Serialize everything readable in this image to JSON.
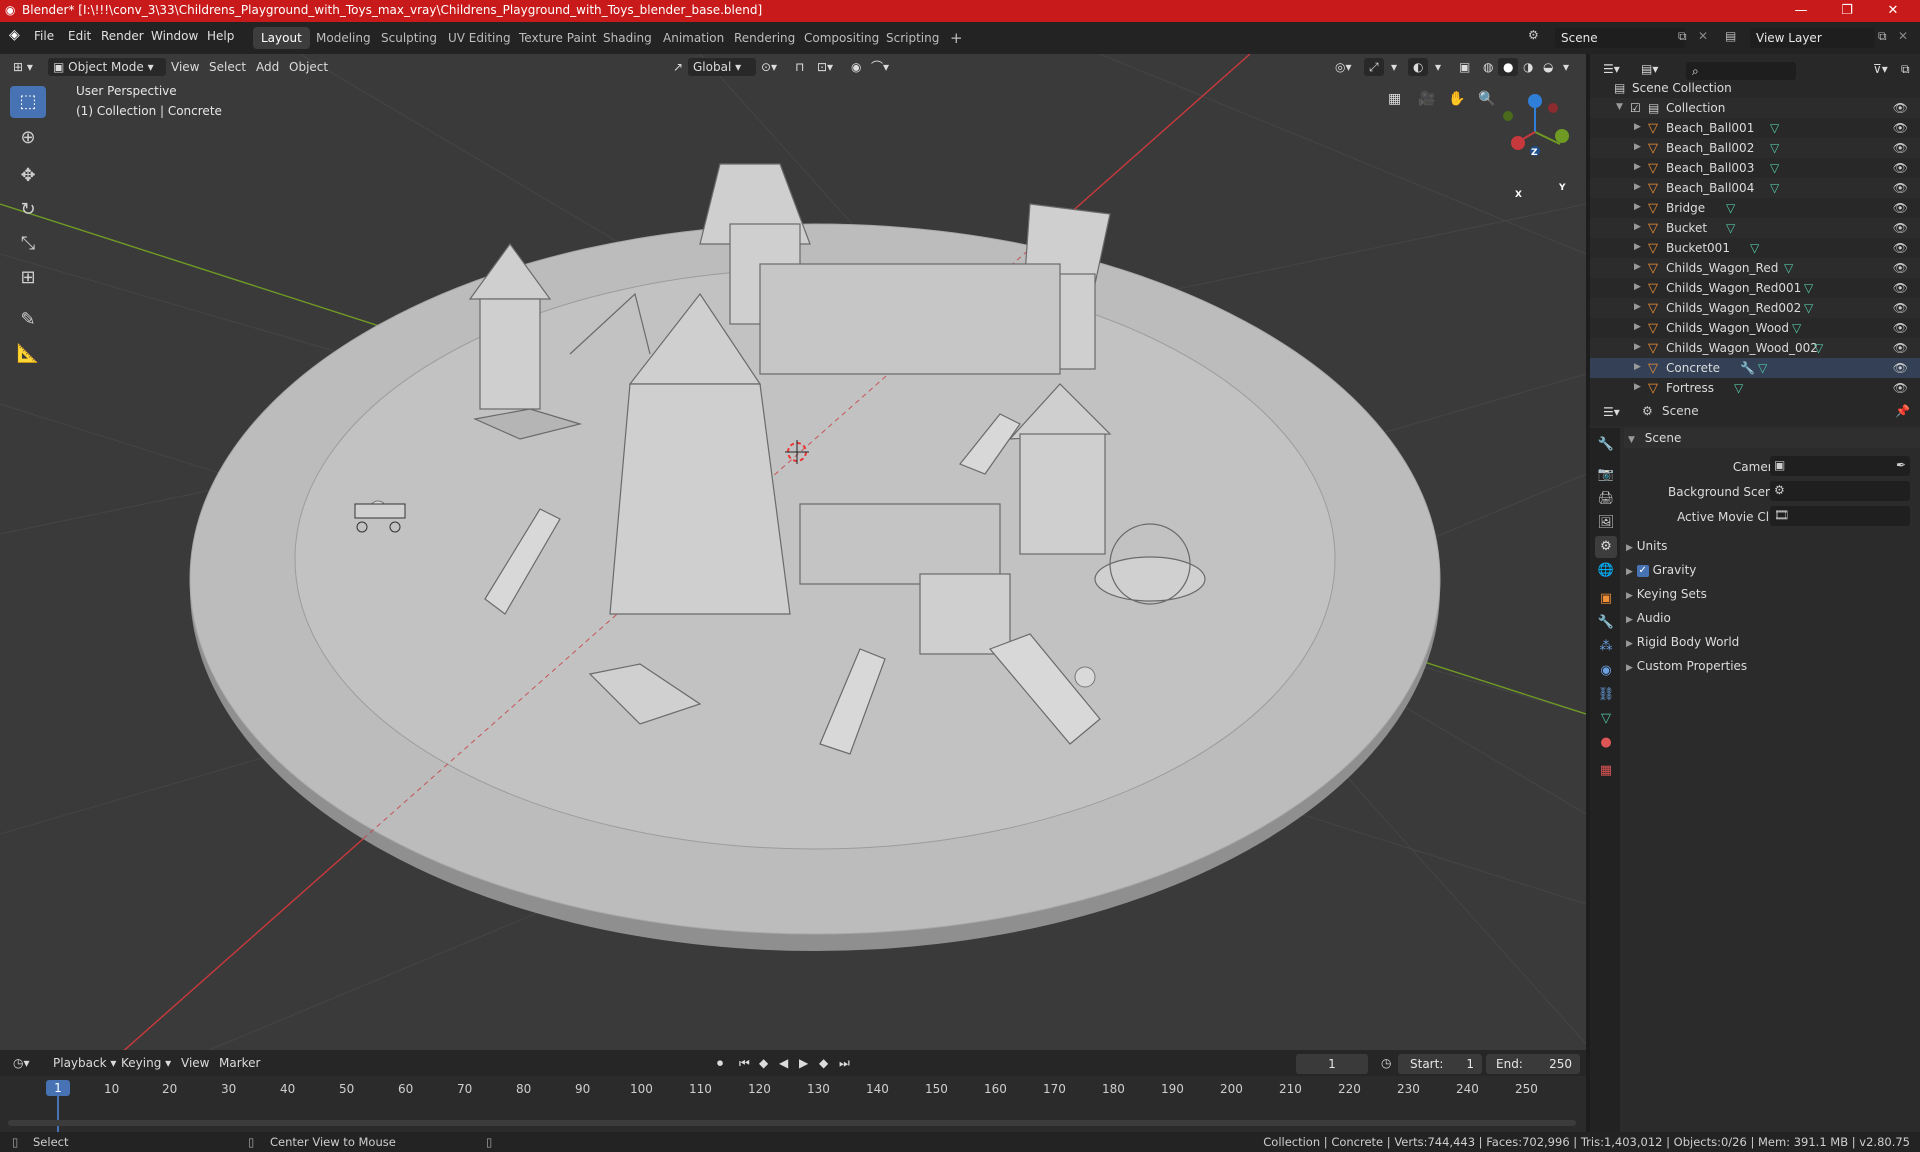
{
  "title_bar": {
    "title": "Blender* [I:\\!!!\\conv_3\\33\\Childrens_Playground_with_Toys_max_vray\\Childrens_Playground_with_Toys_blender_base.blend]",
    "minimize": "—",
    "maximize": "❐",
    "close": "✕"
  },
  "menu": {
    "logo": "◈",
    "items": [
      "File",
      "Edit",
      "Render",
      "Window",
      "Help"
    ],
    "workspaces": [
      "Layout",
      "Modeling",
      "Sculpting",
      "UV Editing",
      "Texture Paint",
      "Shading",
      "Animation",
      "Rendering",
      "Compositing",
      "Scripting"
    ],
    "active_workspace": "Layout",
    "add_tab": "+",
    "scene_label": "Scene",
    "view_layer_label": "View Layer"
  },
  "viewport": {
    "mode": "Object Mode",
    "menu": [
      "View",
      "Select",
      "Add",
      "Object"
    ],
    "orientation": "Global",
    "overlay_title": "User Perspective",
    "overlay_subtitle": "(1) Collection | Concrete",
    "gizmo": {
      "z": "Z",
      "y": "Y",
      "x": "X"
    },
    "colors": {
      "x_axis": "#c8393d",
      "y_axis": "#6f9a24",
      "z_axis": "#2f7fd8",
      "floor": "#bcbcbc",
      "ground": "#3a3a3a"
    }
  },
  "outliner": {
    "search_placeholder": "",
    "root": "Scene Collection",
    "collection": "Collection",
    "items": [
      "Beach_Ball001",
      "Beach_Ball002",
      "Beach_Ball003",
      "Beach_Ball004",
      "Bridge",
      "Bucket",
      "Bucket001",
      "Childs_Wagon_Red",
      "Childs_Wagon_Red001",
      "Childs_Wagon_Red002",
      "Childs_Wagon_Wood",
      "Childs_Wagon_Wood_002",
      "Concrete",
      "Fortress"
    ],
    "selected": "Concrete"
  },
  "properties": {
    "header": "Scene",
    "section": "Scene",
    "camera_label": "Camera",
    "background_scene_label": "Background Scene",
    "active_movie_clip_label": "Active Movie Clip",
    "subsections": [
      "Units",
      "Gravity",
      "Keying Sets",
      "Audio",
      "Rigid Body World",
      "Custom Properties"
    ]
  },
  "timeline": {
    "menu": [
      "Playback",
      "Keying",
      "View",
      "Marker"
    ],
    "current_frame": "1",
    "start_label": "Start:",
    "start": "1",
    "end_label": "End:",
    "end": "250",
    "ruler": [
      "1",
      "10",
      "20",
      "30",
      "40",
      "50",
      "60",
      "70",
      "80",
      "90",
      "100",
      "110",
      "120",
      "130",
      "140",
      "150",
      "160",
      "170",
      "180",
      "190",
      "200",
      "210",
      "220",
      "230",
      "240",
      "250"
    ]
  },
  "status": {
    "left": "Select",
    "middle": "Center View to Mouse",
    "right": "Collection | Concrete | Verts:744,443 | Faces:702,996 | Tris:1,403,012 | Objects:0/26 | Mem: 391.1 MB | v2.80.75"
  }
}
